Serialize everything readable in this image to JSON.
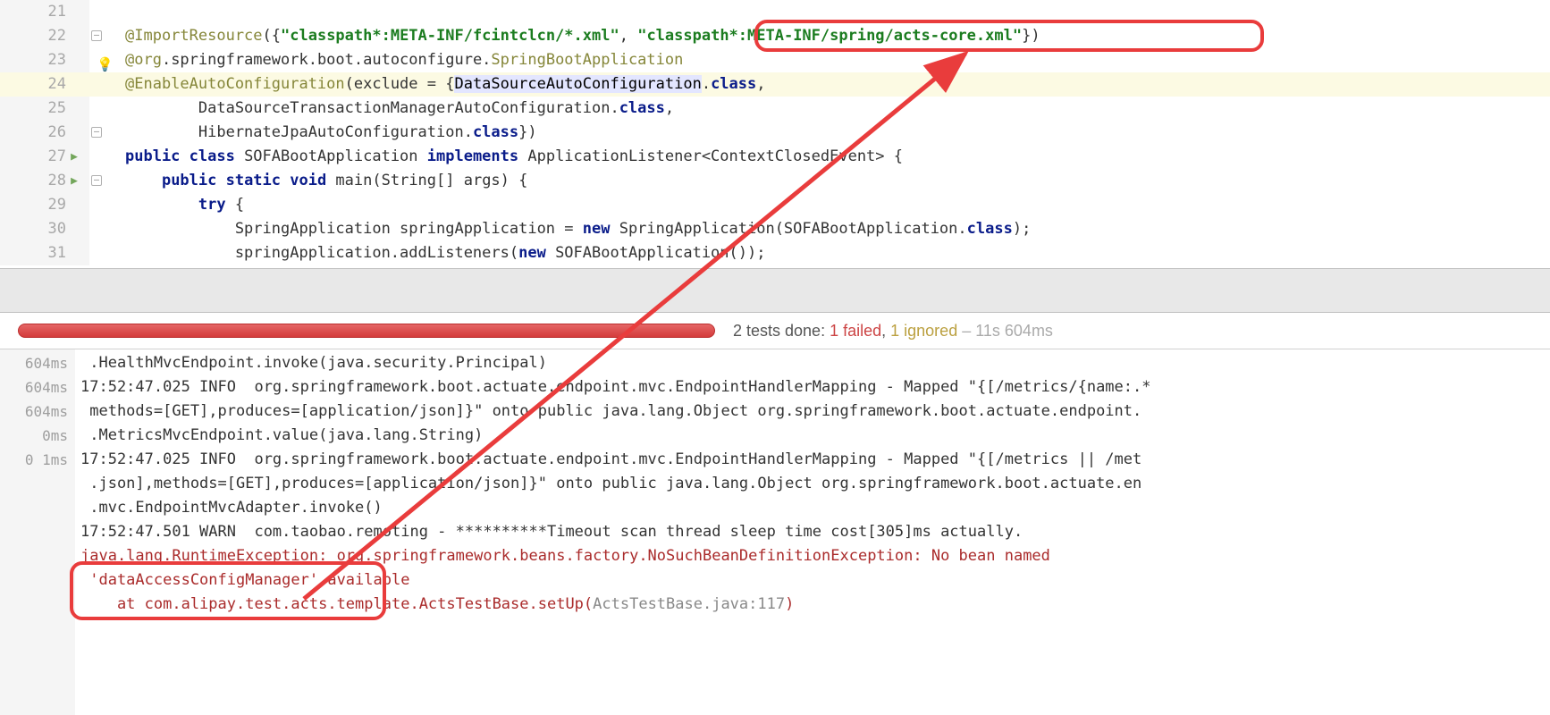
{
  "editor": {
    "lines": [
      {
        "num": 21,
        "segments": []
      },
      {
        "num": 22,
        "hasFoldMinus": true,
        "segments": [
          {
            "c": "ann",
            "t": "@ImportResource"
          },
          {
            "c": "punc",
            "t": "({"
          },
          {
            "c": "str",
            "t": "\"classpath*:META-INF/fcintclcn/*.xml\""
          },
          {
            "c": "punc",
            "t": ", "
          },
          {
            "c": "str",
            "t": "\"classpath*:META-INF/spring/acts-core.xml\""
          },
          {
            "c": "punc",
            "t": "})"
          }
        ]
      },
      {
        "num": 23,
        "lightbulb": true,
        "segments": [
          {
            "c": "ann",
            "t": "@org"
          },
          {
            "c": "cls",
            "t": ".springframework.boot.autoconfigure."
          },
          {
            "c": "ann",
            "t": "SpringBootApplication"
          }
        ]
      },
      {
        "num": 24,
        "highlight": true,
        "segments": [
          {
            "c": "ann",
            "t": "@EnableAutoConfiguration"
          },
          {
            "c": "punc",
            "t": "(exclude = {"
          },
          {
            "c": "caret-sel",
            "t": "DataSourceAutoConfiguration"
          },
          {
            "c": "cls",
            "t": "."
          },
          {
            "c": "kw",
            "t": "class"
          },
          {
            "c": "punc",
            "t": ","
          }
        ]
      },
      {
        "num": 25,
        "segments": [
          {
            "c": "cls",
            "t": "        DataSourceTransactionManagerAutoConfiguration."
          },
          {
            "c": "kw",
            "t": "class"
          },
          {
            "c": "punc",
            "t": ","
          }
        ]
      },
      {
        "num": 26,
        "hasFoldMinus": true,
        "segments": [
          {
            "c": "cls",
            "t": "        HibernateJpaAutoConfiguration."
          },
          {
            "c": "kw",
            "t": "class"
          },
          {
            "c": "punc",
            "t": "})"
          }
        ]
      },
      {
        "num": 27,
        "foldArrow": true,
        "segments": [
          {
            "c": "kw",
            "t": "public class "
          },
          {
            "c": "cls",
            "t": "SOFABootApplication "
          },
          {
            "c": "kw",
            "t": "implements "
          },
          {
            "c": "cls",
            "t": "ApplicationListener<ContextClosedEvent> {"
          }
        ]
      },
      {
        "num": 28,
        "foldArrow": true,
        "hasFoldMinus": true,
        "segments": [
          {
            "c": "cls",
            "t": "    "
          },
          {
            "c": "kw",
            "t": "public static void "
          },
          {
            "c": "mtd",
            "t": "main"
          },
          {
            "c": "cls",
            "t": "(String[] args) {"
          }
        ]
      },
      {
        "num": 29,
        "segments": [
          {
            "c": "cls",
            "t": "        "
          },
          {
            "c": "kw",
            "t": "try "
          },
          {
            "c": "cls",
            "t": "{"
          }
        ]
      },
      {
        "num": 30,
        "segments": [
          {
            "c": "cls",
            "t": "            SpringApplication springApplication = "
          },
          {
            "c": "kw",
            "t": "new "
          },
          {
            "c": "cls",
            "t": "SpringApplication(SOFABootApplication."
          },
          {
            "c": "kw",
            "t": "class"
          },
          {
            "c": "cls",
            "t": ");"
          }
        ]
      },
      {
        "num": 31,
        "segments": [
          {
            "c": "cls",
            "t": "            springApplication.addListeners("
          },
          {
            "c": "kw",
            "t": "new "
          },
          {
            "c": "cls",
            "t": "SOFABootApplication());"
          }
        ]
      }
    ]
  },
  "testStatus": {
    "prefix": "2 tests done: ",
    "failed": "1 failed",
    "sep1": ", ",
    "ignored": "1 ignored",
    "sep2": " – ",
    "duration": "11s 604ms"
  },
  "consoleGutter": [
    "604ms",
    "604ms",
    "604ms",
    "0ms",
    "0 1ms"
  ],
  "console": [
    {
      "c": "",
      "t": " .HealthMvcEndpoint.invoke(java.security.Principal)"
    },
    {
      "c": "",
      "t": "17:52:47.025 INFO  org.springframework.boot.actuate.endpoint.mvc.EndpointHandlerMapping - Mapped \"{[/metrics/{name:.*"
    },
    {
      "c": "",
      "t": " methods=[GET],produces=[application/json]}\" onto public java.lang.Object org.springframework.boot.actuate.endpoint."
    },
    {
      "c": "",
      "t": " .MetricsMvcEndpoint.value(java.lang.String)"
    },
    {
      "c": "",
      "t": "17:52:47.025 INFO  org.springframework.boot.actuate.endpoint.mvc.EndpointHandlerMapping - Mapped \"{[/metrics || /met"
    },
    {
      "c": "",
      "t": " .json],methods=[GET],produces=[application/json]}\" onto public java.lang.Object org.springframework.boot.actuate.en"
    },
    {
      "c": "",
      "t": " .mvc.EndpointMvcAdapter.invoke()"
    },
    {
      "c": "",
      "t": "17:52:47.501 WARN  com.taobao.remoting - **********Timeout scan thread sleep time cost[305]ms actually."
    },
    {
      "c": "",
      "t": ""
    },
    {
      "c": "err",
      "t": "java.lang.RuntimeException: org.springframework.beans.factory.NoSuchBeanDefinitionException: No bean named "
    },
    {
      "c": "err",
      "t": " 'dataAccessConfigManager' available"
    },
    {
      "c": "",
      "t": ""
    },
    {
      "c": "err",
      "t": "    at com.alipay.test.acts.template.ActsTestBase.setUp(ActsTestBase.java:117)",
      "dimParam": "ActsTestBase.java:117"
    }
  ]
}
